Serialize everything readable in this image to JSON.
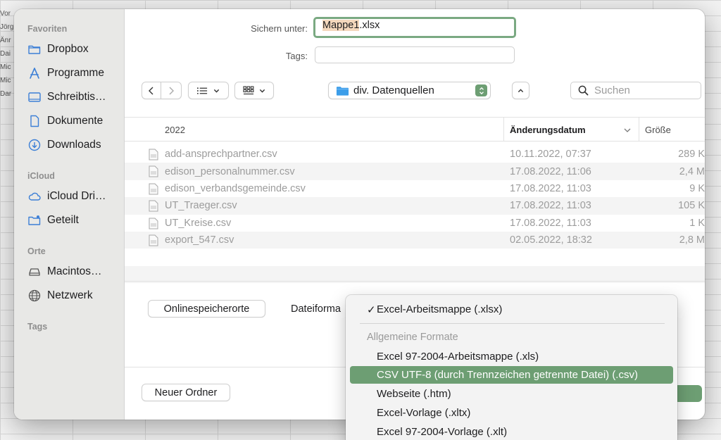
{
  "background": {
    "row_labels": [
      "Vor",
      "Jörg",
      "Änr",
      "Dai",
      "Mic",
      "Mic",
      "Dar"
    ]
  },
  "sidebar": {
    "favorites_header": "Favoriten",
    "favorites": [
      {
        "label": "Dropbox",
        "icon": "folder-icon"
      },
      {
        "label": "Programme",
        "icon": "apps-icon"
      },
      {
        "label": "Schreibtis…",
        "icon": "desktop-icon"
      },
      {
        "label": "Dokumente",
        "icon": "document-icon"
      },
      {
        "label": "Downloads",
        "icon": "download-icon"
      }
    ],
    "icloud_header": "iCloud",
    "icloud": [
      {
        "label": "iCloud Dri…",
        "icon": "cloud-icon"
      },
      {
        "label": "Geteilt",
        "icon": "shared-folder-icon"
      }
    ],
    "locations_header": "Orte",
    "locations": [
      {
        "label": "Macintos…",
        "icon": "disk-icon"
      },
      {
        "label": "Netzwerk",
        "icon": "globe-icon"
      }
    ],
    "tags_header": "Tags"
  },
  "save": {
    "save_as_label": "Sichern unter:",
    "filename_selected": "Mappe1",
    "filename_ext": ".xlsx",
    "tags_label": "Tags:",
    "tags_value": ""
  },
  "toolbar": {
    "location": "div. Datenquellen",
    "search_placeholder": "Suchen"
  },
  "file_list": {
    "col_name": "2022",
    "col_date": "Änderungsdatum",
    "col_size": "Größe",
    "rows": [
      {
        "name": "add-ansprechpartner.csv",
        "date": "10.11.2022, 07:37",
        "size": "289 K"
      },
      {
        "name": "edison_personalnummer.csv",
        "date": "17.08.2022, 11:06",
        "size": "2,4 M"
      },
      {
        "name": "edison_verbandsgemeinde.csv",
        "date": "17.08.2022, 11:03",
        "size": "9 K"
      },
      {
        "name": "UT_Traeger.csv",
        "date": "17.08.2022, 11:03",
        "size": "105 K"
      },
      {
        "name": "UT_Kreise.csv",
        "date": "17.08.2022, 11:03",
        "size": "1 K"
      },
      {
        "name": "export_547.csv",
        "date": "02.05.2022, 18:32",
        "size": "2,8 M"
      }
    ]
  },
  "options": {
    "online_locations": "Onlinespeicherorte",
    "format_label": "Dateiforma"
  },
  "footer": {
    "new_folder": "Neuer Ordner"
  },
  "format_menu": {
    "checkmark": "✓",
    "selected": "Excel-Arbeitsmappe (.xlsx)",
    "group_header": "Allgemeine Formate",
    "items": [
      "Excel 97-2004-Arbeitsmappe (.xls)",
      "CSV UTF-8 (durch Trennzeichen getrennte Datei) (.csv)",
      "Webseite (.htm)",
      "Excel-Vorlage (.xltx)",
      "Excel 97-2004-Vorlage (.xlt)"
    ],
    "highlighted_index": 1
  },
  "colors": {
    "accent": "#6d9e73",
    "focus_ring": "#7aa982",
    "folder": "#3b9de9"
  }
}
